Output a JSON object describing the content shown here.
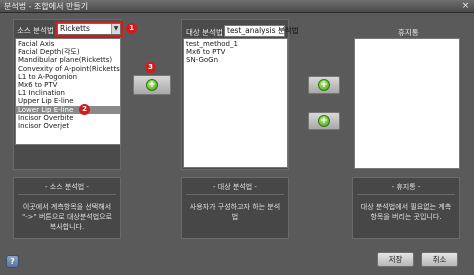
{
  "window": {
    "title": "분석법 - 조합에서 만들기",
    "close_glyph": "×"
  },
  "source": {
    "label": "소스 분석법",
    "selected": "Ricketts",
    "items": [
      "Facial Axis",
      "Facial Depth(각도)",
      "Mandibular plane(Ricketts)",
      "Convexity of A-point(Ricketts)",
      "L1 to A-Pogonion",
      "Mx6 to PTV",
      "L1 Inclination",
      "Upper Lip E-line",
      "Lower Lip E-line",
      "Incisor Overbite",
      "Incisor Overjet"
    ],
    "selected_index": 8,
    "desc_title": "- 소스 분석법 -",
    "desc_text": "이곳에서 계측항목을 선택해서 \"->\" 버튼으로 대상분석법으로 복사합니다."
  },
  "target": {
    "label": "대상 분석법",
    "name_value": "test_analysis 분석법",
    "items": [
      "test_method_1",
      "Mx6 to PTV",
      "SN-GoGn"
    ],
    "desc_title": "- 대상 분석법 -",
    "desc_text": "사용자가 구성하고자 하는 분석법"
  },
  "trash": {
    "label": "휴지통",
    "desc_title": "- 휴지통 -",
    "desc_text": "대상 분석법에서 필요없는 계측항목을 버리는 곳입니다."
  },
  "badges": [
    "1",
    "2",
    "3"
  ],
  "buttons": {
    "save": "저장",
    "cancel": "취소",
    "help": "?"
  },
  "colors": {
    "highlight": "#d01c1c",
    "add_button": "#3d9a17",
    "selected_item": "#8a8a8a"
  },
  "icons": {
    "add": "plus-circle-icon",
    "help": "help-icon",
    "combo_arrow": "chevron-down-icon"
  }
}
